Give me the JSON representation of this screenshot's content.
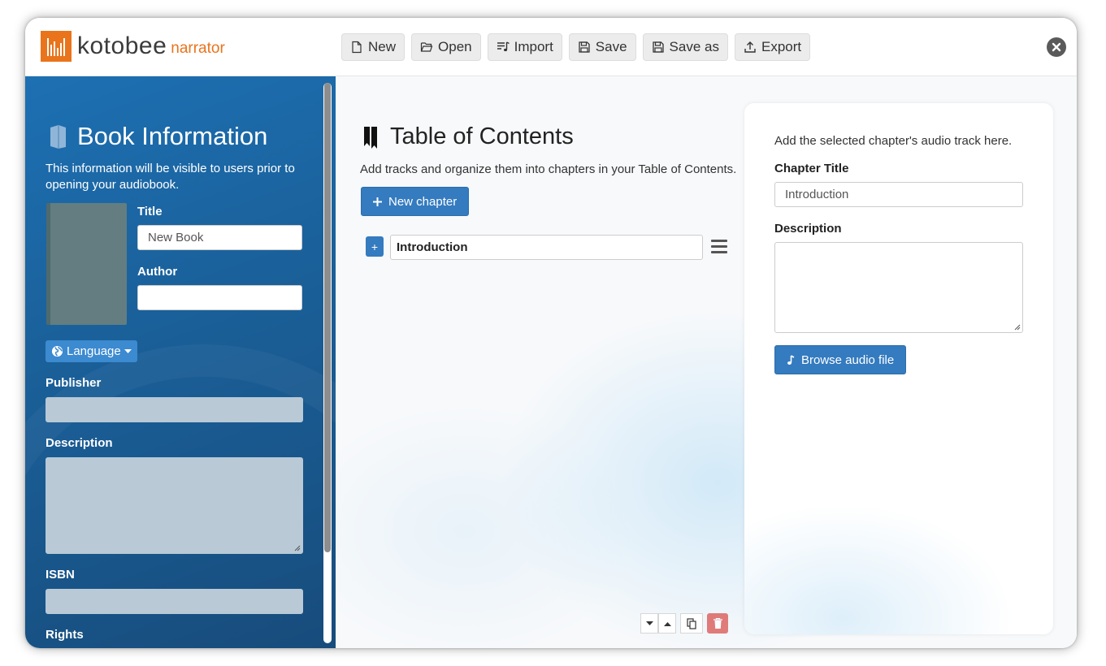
{
  "app": {
    "logo_name": "kotobee",
    "logo_sub": "narrator",
    "accent_color": "#e9741c",
    "primary_color": "#347bbf"
  },
  "toolbar": {
    "buttons": [
      {
        "label": "New",
        "icon": "file-icon"
      },
      {
        "label": "Open",
        "icon": "folder-open-icon"
      },
      {
        "label": "Import",
        "icon": "import-music-icon"
      },
      {
        "label": "Save",
        "icon": "floppy-disk-icon"
      },
      {
        "label": "Save as",
        "icon": "floppy-disk-icon"
      },
      {
        "label": "Export",
        "icon": "export-icon"
      }
    ]
  },
  "sidebar": {
    "title": "Book Information",
    "description": "This information will be visible to users prior to opening your audiobook.",
    "title_label": "Title",
    "title_placeholder": "New Book",
    "author_label": "Author",
    "author_value": "",
    "language_label": "Language",
    "publisher_label": "Publisher",
    "description_label": "Description",
    "isbn_label": "ISBN",
    "rights_label": "Rights"
  },
  "main": {
    "title": "Table of Contents",
    "description": "Add tracks and organize them into chapters in your Table of Contents.",
    "new_chapter_label": "New chapter",
    "chapters": [
      {
        "title": "Introduction"
      }
    ]
  },
  "panel": {
    "hint": "Add the selected chapter's audio track here.",
    "chapter_title_label": "Chapter Title",
    "chapter_title_value": "Introduction",
    "description_label": "Description",
    "browse_label": "Browse audio file"
  }
}
